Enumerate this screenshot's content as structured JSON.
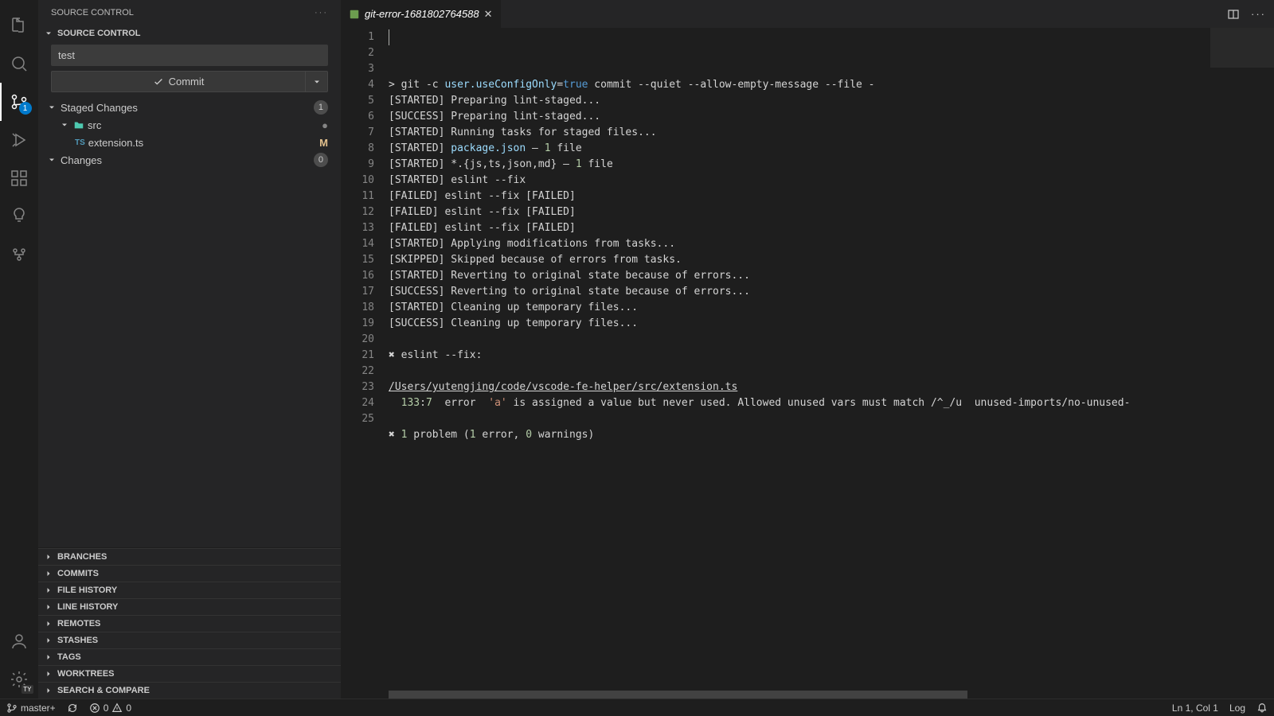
{
  "sidebar": {
    "title": "SOURCE CONTROL",
    "section_label": "SOURCE CONTROL",
    "commit_message": "test",
    "commit_button": "Commit",
    "groups": {
      "staged": {
        "label": "Staged Changes",
        "count": "1"
      },
      "changes": {
        "label": "Changes",
        "count": "0"
      }
    },
    "folder": {
      "name": "src"
    },
    "file": {
      "name": "extension.ts",
      "status": "M",
      "lang_badge": "TS"
    },
    "collapsed": [
      "BRANCHES",
      "COMMITS",
      "FILE HISTORY",
      "LINE HISTORY",
      "REMOTES",
      "STASHES",
      "TAGS",
      "WORKTREES",
      "SEARCH & COMPARE"
    ]
  },
  "activity": {
    "scm_badge": "1",
    "settings_badge": "TY"
  },
  "tab": {
    "title": "git-error-1681802764588"
  },
  "editor": {
    "lines": [
      [
        {
          "t": "> git -c ",
          "c": ""
        },
        {
          "t": "user.useConfigOnly",
          "c": "tok-cmd"
        },
        {
          "t": "=",
          "c": ""
        },
        {
          "t": "true",
          "c": "tok-kw"
        },
        {
          "t": " commit --quiet --allow-empty-message --file -",
          "c": ""
        }
      ],
      [
        {
          "t": "[STARTED] Preparing lint-staged...",
          "c": ""
        }
      ],
      [
        {
          "t": "[SUCCESS] Preparing lint-staged...",
          "c": ""
        }
      ],
      [
        {
          "t": "[STARTED] Running tasks for staged files...",
          "c": ""
        }
      ],
      [
        {
          "t": "[STARTED] ",
          "c": ""
        },
        {
          "t": "package.json",
          "c": "tok-pkg"
        },
        {
          "t": " — ",
          "c": ""
        },
        {
          "t": "1",
          "c": "tok-num"
        },
        {
          "t": " file",
          "c": ""
        }
      ],
      [
        {
          "t": "[STARTED] *.{js,ts,json,md} — ",
          "c": ""
        },
        {
          "t": "1",
          "c": "tok-num"
        },
        {
          "t": " file",
          "c": ""
        }
      ],
      [
        {
          "t": "[STARTED] eslint --fix",
          "c": ""
        }
      ],
      [
        {
          "t": "[FAILED] eslint --fix [FAILED]",
          "c": ""
        }
      ],
      [
        {
          "t": "[FAILED] eslint --fix [FAILED]",
          "c": ""
        }
      ],
      [
        {
          "t": "[FAILED] eslint --fix [FAILED]",
          "c": ""
        }
      ],
      [
        {
          "t": "[STARTED] Applying modifications from tasks...",
          "c": ""
        }
      ],
      [
        {
          "t": "[SKIPPED] Skipped because of errors from tasks.",
          "c": ""
        }
      ],
      [
        {
          "t": "[STARTED] Reverting to original state because of errors...",
          "c": ""
        }
      ],
      [
        {
          "t": "[SUCCESS] Reverting to original state because of errors...",
          "c": ""
        }
      ],
      [
        {
          "t": "[STARTED] Cleaning up temporary files...",
          "c": ""
        }
      ],
      [
        {
          "t": "[SUCCESS] Cleaning up temporary files...",
          "c": ""
        }
      ],
      [
        {
          "t": "",
          "c": ""
        }
      ],
      [
        {
          "t": "✖ eslint --fix:",
          "c": ""
        }
      ],
      [
        {
          "t": "",
          "c": ""
        }
      ],
      [
        {
          "t": "/Users/yutengjing/code/vscode-fe-helper/src/extension.ts",
          "c": "tok-underline"
        }
      ],
      [
        {
          "t": "  ",
          "c": ""
        },
        {
          "t": "133",
          "c": "tok-num"
        },
        {
          "t": ":",
          "c": ""
        },
        {
          "t": "7",
          "c": "tok-num"
        },
        {
          "t": "  error  ",
          "c": ""
        },
        {
          "t": "'a'",
          "c": "tok-str"
        },
        {
          "t": " is assigned a value but never used. Allowed unused vars must match /^_/u  unused-imports/no-unused-",
          "c": ""
        }
      ],
      [
        {
          "t": "",
          "c": ""
        }
      ],
      [
        {
          "t": "✖ ",
          "c": ""
        },
        {
          "t": "1",
          "c": "tok-num"
        },
        {
          "t": " problem (",
          "c": ""
        },
        {
          "t": "1",
          "c": "tok-num"
        },
        {
          "t": " error, ",
          "c": ""
        },
        {
          "t": "0",
          "c": "tok-num"
        },
        {
          "t": " warnings)",
          "c": ""
        }
      ],
      [
        {
          "t": "",
          "c": ""
        }
      ],
      [
        {
          "t": "",
          "c": ""
        }
      ]
    ]
  },
  "status": {
    "branch": "master+",
    "errors": "0",
    "warnings": "0",
    "position": "Ln 1, Col 1",
    "log": "Log"
  }
}
